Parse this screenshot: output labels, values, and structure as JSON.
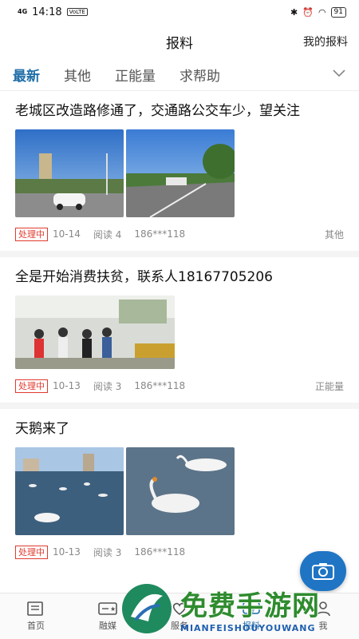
{
  "status": {
    "net": "4G",
    "time": "14:18",
    "chip": "VoLTE",
    "battery": "91"
  },
  "header": {
    "title": "报料",
    "right_link": "我的报料"
  },
  "tabs": [
    {
      "label": "最新"
    },
    {
      "label": "其他"
    },
    {
      "label": "正能量"
    },
    {
      "label": "求帮助"
    }
  ],
  "posts": [
    {
      "title": "老城区改造路修通了，交通路公交车少，望关注",
      "status": "处理中",
      "date": "10-14",
      "reads": "阅读 4",
      "user": "186***118",
      "category": "其他"
    },
    {
      "title": "全是开始消费扶贫，联系人18167705206",
      "status": "处理中",
      "date": "10-13",
      "reads": "阅读 3",
      "user": "186***118",
      "category": "正能量"
    },
    {
      "title": "天鹅来了",
      "status": "处理中",
      "date": "10-13",
      "reads": "阅读 3",
      "user": "186***118",
      "category": ""
    }
  ],
  "bottom_nav": [
    {
      "label": "首页"
    },
    {
      "label": "融媒"
    },
    {
      "label": "服务"
    },
    {
      "label": "报料"
    },
    {
      "label": "我"
    }
  ],
  "watermark": {
    "cn": "免费手游网",
    "en": "MIANFEISHOUYOUWANG"
  },
  "colors": {
    "accent": "#1f6ea8",
    "status_red": "#e03b2f",
    "fab": "#1f75c4"
  }
}
